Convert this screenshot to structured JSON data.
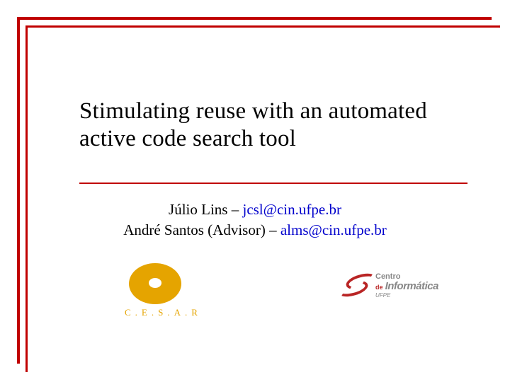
{
  "title": "Stimulating reuse with an automated active code search tool",
  "authors": {
    "line1_name": "Júlio Lins – ",
    "line1_email": "jcsl@cin.ufpe.br",
    "line2_name": "André Santos (Advisor) – ",
    "line2_email": "alms@cin.ufpe.br"
  },
  "logos": {
    "left_text": "C.E.S.A.R",
    "right_line1": "Centro",
    "right_line2": "de",
    "right_line3": "Informática",
    "right_line4": "UFPE"
  },
  "colors": {
    "accent": "#c00000",
    "link": "#0000cc",
    "cesar": "#e5a400",
    "cin": "#b92525"
  }
}
